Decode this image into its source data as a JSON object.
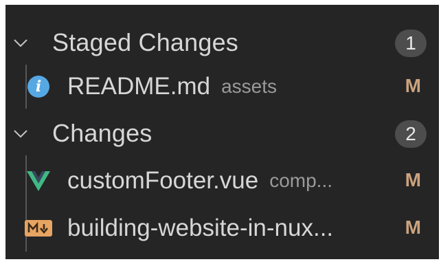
{
  "scm": {
    "staged": {
      "title": "Staged Changes",
      "count": "1",
      "files": [
        {
          "name": "README.md",
          "dir": "assets",
          "status": "M",
          "icon": "info-icon"
        }
      ]
    },
    "changes": {
      "title": "Changes",
      "count": "2",
      "files": [
        {
          "name": "customFooter.vue",
          "dir": "comp...",
          "status": "M",
          "icon": "vue-icon"
        },
        {
          "name": "building-website-in-nux...",
          "dir": "",
          "status": "M",
          "icon": "markdown-icon"
        }
      ]
    }
  },
  "colors": {
    "background": "#252526",
    "text": "#d7d7d7",
    "muted_text": "#9a9a9a",
    "modified": "#cba37f",
    "badge": "#4d4d4d",
    "info_icon": "#56a8e3",
    "vue_green": "#41b883",
    "markdown_orange": "#e7a462"
  }
}
